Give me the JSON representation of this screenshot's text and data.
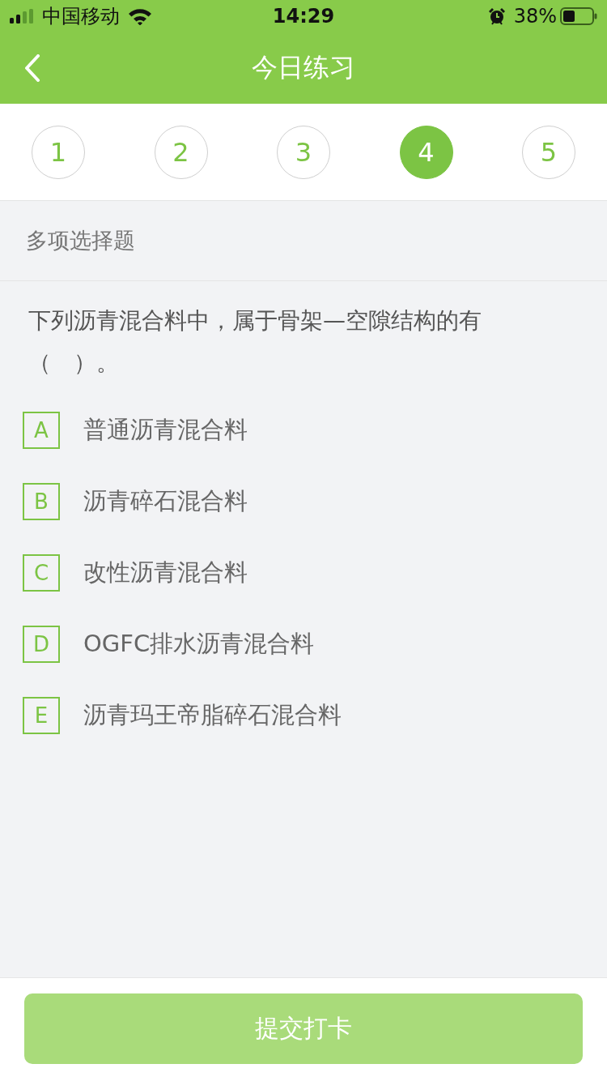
{
  "status_bar": {
    "carrier": "中国移动",
    "time": "14:29",
    "battery": "38%"
  },
  "nav_bar": {
    "title": "今日练习"
  },
  "question_steps": [
    {
      "label": "1",
      "selected": false
    },
    {
      "label": "2",
      "selected": false
    },
    {
      "label": "3",
      "selected": false
    },
    {
      "label": "4",
      "selected": true
    },
    {
      "label": "5",
      "selected": false
    }
  ],
  "question": {
    "type": "多项选择题",
    "text": "下列沥青混合料中，属于骨架—空隙结构的有（　）。",
    "options": [
      {
        "letter": "A",
        "text": "普通沥青混合料",
        "selected": false
      },
      {
        "letter": "B",
        "text": "沥青碎石混合料",
        "selected": false
      },
      {
        "letter": "C",
        "text": "改性沥青混合料",
        "selected": false
      },
      {
        "letter": "D",
        "text": "OGFC排水沥青混合料",
        "selected": false
      },
      {
        "letter": "E",
        "text": "沥青玛王帝脂碎石混合料",
        "selected": false
      }
    ]
  },
  "submit_button": {
    "label": "提交打卡",
    "disabled": true
  }
}
